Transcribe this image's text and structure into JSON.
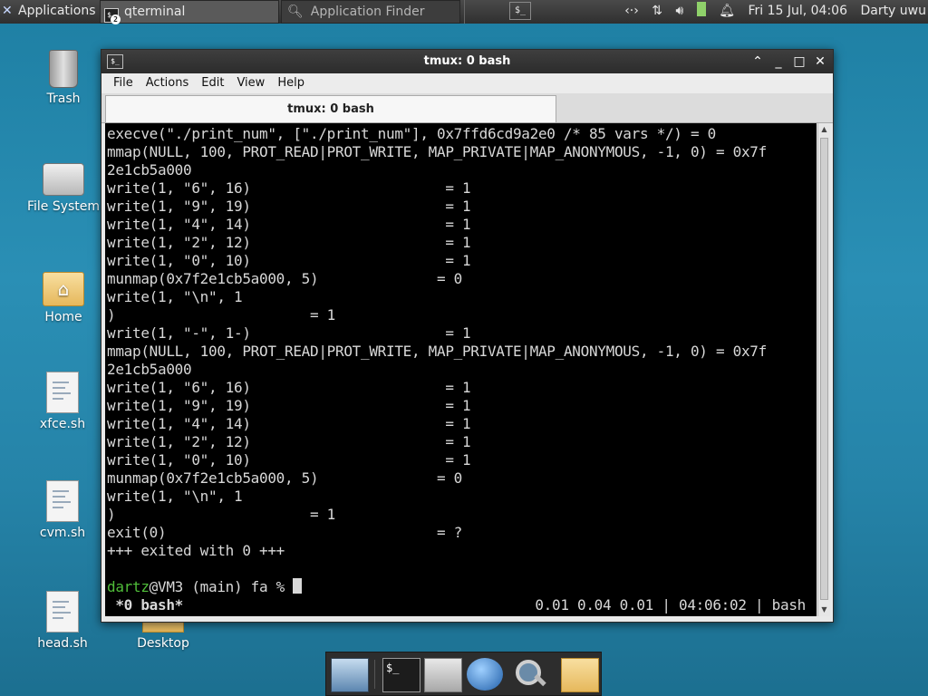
{
  "panel": {
    "applications_label": "Applications",
    "tasks": [
      {
        "label": "qterminal",
        "badge": "2"
      },
      {
        "label": "Application Finder"
      }
    ],
    "tray": {
      "clock": "Fri 15 Jul, 04:06",
      "user": "Darty uwu"
    }
  },
  "desktop": {
    "icons": [
      {
        "label": "Trash"
      },
      {
        "label": "File System"
      },
      {
        "label": "Home"
      },
      {
        "label": "xfce.sh"
      },
      {
        "label": "cvm.sh"
      },
      {
        "label": "head.sh"
      },
      {
        "label": "Desktop"
      }
    ]
  },
  "window": {
    "title": "tmux: 0 bash",
    "menu": [
      "File",
      "Actions",
      "Edit",
      "View",
      "Help"
    ],
    "tab_label": "tmux: 0 bash"
  },
  "terminal": {
    "lines": [
      "execve(\"./print_num\", [\"./print_num\"], 0x7ffd6cd9a2e0 /* 85 vars */) = 0",
      "mmap(NULL, 100, PROT_READ|PROT_WRITE, MAP_PRIVATE|MAP_ANONYMOUS, -1, 0) = 0x7f",
      "2e1cb5a000",
      "write(1, \"6\", 16)                       = 1",
      "write(1, \"9\", 19)                       = 1",
      "write(1, \"4\", 14)                       = 1",
      "write(1, \"2\", 12)                       = 1",
      "write(1, \"0\", 10)                       = 1",
      "munmap(0x7f2e1cb5a000, 5)              = 0",
      "write(1, \"\\n\", 1",
      ")                       = 1",
      "write(1, \"-\", 1-)                       = 1",
      "mmap(NULL, 100, PROT_READ|PROT_WRITE, MAP_PRIVATE|MAP_ANONYMOUS, -1, 0) = 0x7f",
      "2e1cb5a000",
      "write(1, \"6\", 16)                       = 1",
      "write(1, \"9\", 19)                       = 1",
      "write(1, \"4\", 14)                       = 1",
      "write(1, \"2\", 12)                       = 1",
      "write(1, \"0\", 10)                       = 1",
      "munmap(0x7f2e1cb5a000, 5)              = 0",
      "write(1, \"\\n\", 1",
      ")                       = 1",
      "exit(0)                                = ?",
      "+++ exited with 0 +++",
      ""
    ],
    "prompt": {
      "user": "dartz",
      "rest": "@VM3 (main) fa % "
    },
    "status_left": " *0 bash*",
    "status_right": "0.01 0.04 0.01 | 04:06:02 | bash"
  }
}
